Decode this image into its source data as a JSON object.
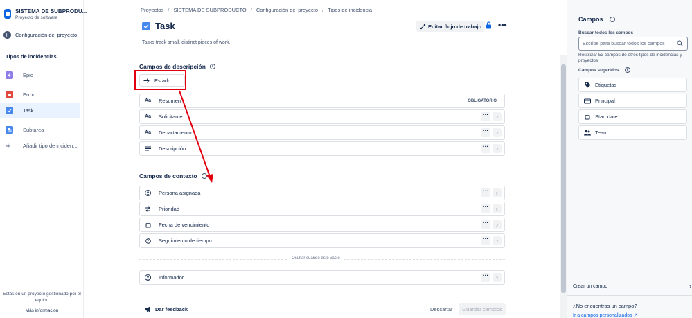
{
  "project": {
    "name": "SISTEMA DE SUBPRODU...",
    "type": "Proyecto de software"
  },
  "sidebar": {
    "back_label": "Configuración del proyecto",
    "section_title": "Tipos de incidencias",
    "items": [
      {
        "label": "Epic",
        "color": "#8f7ee7"
      },
      {
        "label": "Error",
        "color": "#e2483d"
      },
      {
        "label": "Task",
        "color": "#4688ec"
      },
      {
        "label": "Subtarea",
        "color": "#4688ec"
      }
    ],
    "add_label": "Añadir tipo de inciden...",
    "footer_text": "Estás en un proyecto gestionado por el equipo",
    "footer_link": "Más información"
  },
  "breadcrumb": [
    "Proyectos",
    "SISTEMA DE SUBPRODUCTO",
    "Configuración del proyecto",
    "Tipos de incidencia"
  ],
  "header": {
    "title": "Task",
    "edit_workflow": "Editar flujo de trabajo",
    "description": "Tasks track small, distinct pieces of work."
  },
  "description_fields": {
    "title": "Campos de descripción",
    "estado": "Estado",
    "rows": [
      {
        "label": "Resumen",
        "badge": "OBLIGATORIO",
        "icon": "text-icon"
      },
      {
        "label": "Solicitante",
        "icon": "text-icon"
      },
      {
        "label": "Departamento",
        "icon": "text-icon"
      },
      {
        "label": "Descripción",
        "icon": "paragraph-icon"
      }
    ]
  },
  "context_fields": {
    "title": "Campos de contexto",
    "rows": [
      {
        "label": "Persona asignada",
        "icon": "person-icon"
      },
      {
        "label": "Prioridad",
        "icon": "priority-icon"
      },
      {
        "label": "Fecha de vencimiento",
        "icon": "calendar-icon"
      },
      {
        "label": "Seguimiento de tiempo",
        "icon": "stopwatch-icon"
      }
    ],
    "hidden_label": "Ocultar cuando esté vacío",
    "hidden_rows": [
      {
        "label": "Informador",
        "icon": "person-icon"
      }
    ]
  },
  "footer": {
    "feedback": "Dar feedback",
    "cancel": "Descartar",
    "save": "Guardar cambios"
  },
  "right_panel": {
    "title": "Campos",
    "search_label": "Buscar todos los campos",
    "search_placeholder": "Escribe para buscar todos los campos",
    "help": "Reutilizar 53 campos de otros tipos de incidencias y proyectos",
    "suggested_title": "Campos sugeridos",
    "suggested": [
      {
        "label": "Etiquetas",
        "icon": "tag-icon"
      },
      {
        "label": "Principal",
        "icon": "parent-icon"
      },
      {
        "label": "Start date",
        "icon": "calendar-icon"
      },
      {
        "label": "Team",
        "icon": "people-icon"
      }
    ],
    "create": "Crear un campo",
    "not_found": "¿No encuentras un campo?",
    "custom_link": "Ir a campos personalizados"
  },
  "colors": {
    "accent": "#0c66e4",
    "highlight": "#e2000f"
  }
}
